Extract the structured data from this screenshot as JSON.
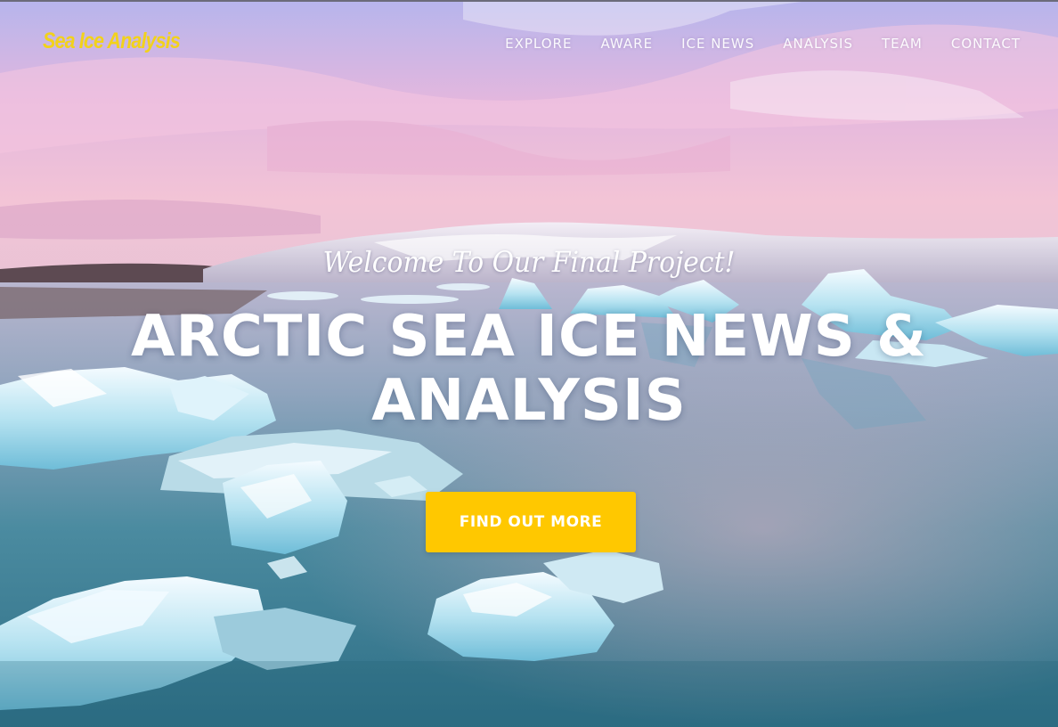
{
  "navbar": {
    "brand": "Sea Ice Analysis",
    "links": [
      "EXPLORE",
      "AWARE",
      "ICE NEWS",
      "ANALYSIS",
      "TEAM",
      "CONTACT"
    ]
  },
  "hero": {
    "subtitle": "Welcome To Our Final Project!",
    "headline": "ARCTIC SEA ICE NEWS & ANALYSIS",
    "cta_label": "FIND OUT MORE"
  },
  "colors": {
    "brand": "#f2d21b",
    "cta_background": "#ffc800",
    "nav_text": "#ffffff"
  }
}
